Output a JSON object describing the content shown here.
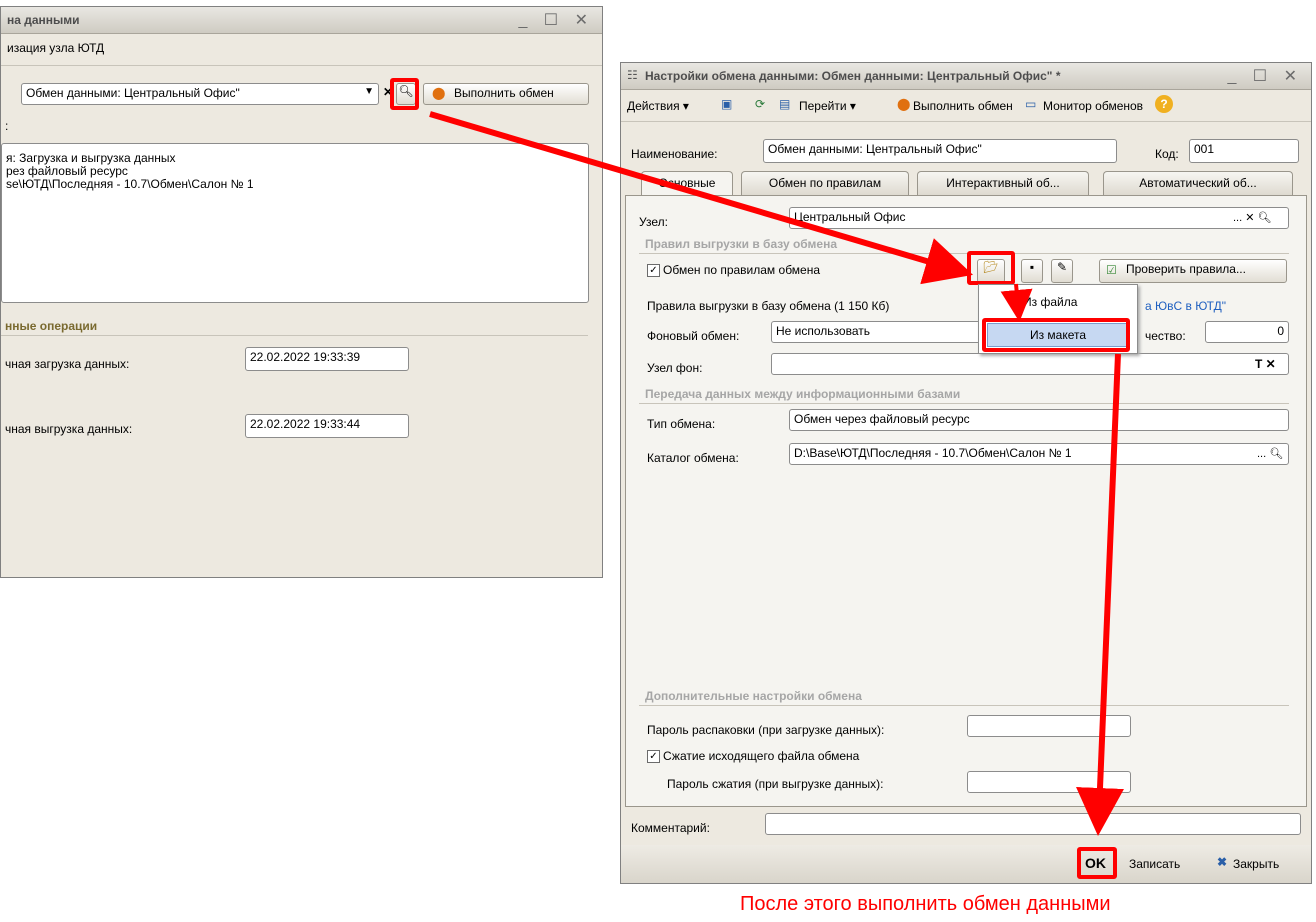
{
  "left_window": {
    "title": "на данными",
    "subtitle": "изация узла ЮТД",
    "node_select_value": "Обмен данными: Центральный Офис\"",
    "run_exchange_label": "Выполнить обмен",
    "colon_label": ":",
    "description_lines": [
      "я: Загрузка и выгрузка данных",
      "рез файловый ресурс",
      "se\\ЮТД\\Последняя - 10.7\\Обмен\\Салон № 1"
    ],
    "ops_header": "нные операции",
    "last_load_label": "чная загрузка данных:",
    "last_load_value": "22.02.2022 19:33:39",
    "last_unload_label": "чная выгрузка данных:",
    "last_unload_value": "22.02.2022 19:33:44"
  },
  "right_window": {
    "title": "Настройки обмена данными: Обмен данными: Центральный Офис\" *",
    "toolbar": {
      "actions": "Действия",
      "goto": "Перейти",
      "run_exchange": "Выполнить обмен",
      "monitor": "Монитор обменов"
    },
    "name_label": "Наименование:",
    "name_value": "Обмен данными: Центральный Офис\"",
    "code_label": "Код:",
    "code_value": "001",
    "tabs": [
      "Основные",
      "Обмен по правилам",
      "Интерактивный об...",
      "Автоматический об..."
    ],
    "node_label": "Узел:",
    "node_value": "Центральный Офис",
    "rules_section": "Правил выгрузки в базу обмена",
    "rules_checkbox": "Обмен по правилам обмена",
    "check_rules_btn": "Проверить правила...",
    "rules_info": "Правила выгрузки в базу обмена (1 150 Кб)",
    "rules_link": "а ЮвС в ЮТД\"",
    "bg_exchange_label": "Фоновый обмен:",
    "bg_exchange_value": "Не использовать",
    "quantity_label": "чество:",
    "quantity_value": "0",
    "bg_node_label": "Узел фон:",
    "transfer_section": "Передача данных между информационными базами",
    "exchange_type_label": "Тип обмена:",
    "exchange_type_value": "Обмен через файловый ресурс",
    "catalog_label": "Каталог обмена:",
    "catalog_value": "D:\\Base\\ЮТД\\Последняя - 10.7\\Обмен\\Салон № 1",
    "extra_section": "Дополнительные настройки обмена",
    "unpack_pwd_label": "Пароль распаковки (при загрузке данных):",
    "compress_checkbox": "Сжатие исходящего файла обмена",
    "compress_pwd_label": "Пароль сжатия (при выгрузке данных):",
    "comment_label": "Комментарий:",
    "ok_btn": "OK",
    "save_btn": "Записать",
    "close_btn": "Закрыть"
  },
  "dropdown": {
    "items": [
      "Из файла",
      "Из макета"
    ]
  },
  "caption": "После этого выполнить обмен данными",
  "colors": {
    "accent_red": "#ff0000",
    "section_gray": "#a6a6a6",
    "window_bg": "#ede9e0"
  }
}
